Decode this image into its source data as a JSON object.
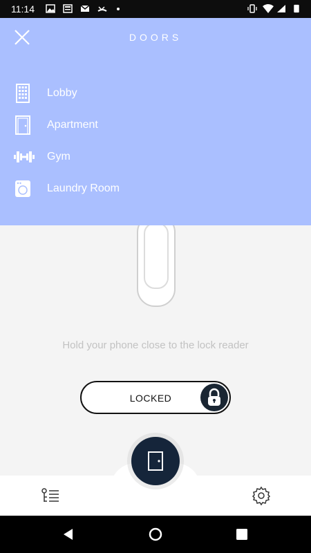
{
  "status_bar": {
    "time": "11:14"
  },
  "drawer": {
    "title": "DOORS",
    "items": [
      {
        "label": "Lobby",
        "icon": "building-icon"
      },
      {
        "label": "Apartment",
        "icon": "door-icon"
      },
      {
        "label": "Gym",
        "icon": "dumbbell-icon"
      },
      {
        "label": "Laundry Room",
        "icon": "washing-machine-icon"
      }
    ]
  },
  "main": {
    "hint": "Hold your phone close to the lock reader",
    "lock_status": "LOCKED"
  },
  "colors": {
    "drawer_bg": "#aabfff",
    "fab_bg": "#15253a",
    "knob_bg": "#1a2633"
  }
}
